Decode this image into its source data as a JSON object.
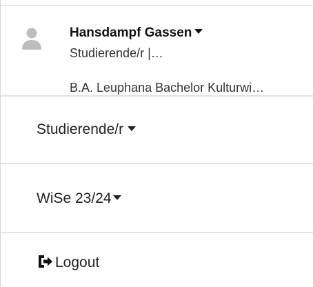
{
  "profile": {
    "name": "Hansdampf Gassen",
    "role_short": "Studierende/r  |…",
    "program": "B.A. Leuphana Bachelor Kulturwi…",
    "avatar_icon": "user-silhouette-icon"
  },
  "menu": {
    "role": "Studierende/r",
    "semester": "WiSe 23/24",
    "logout": "Logout",
    "logout_icon": "logout-icon"
  },
  "colors": {
    "divider": "#e2e2e2",
    "avatar": "#bdbdbd",
    "text": "#222222"
  }
}
